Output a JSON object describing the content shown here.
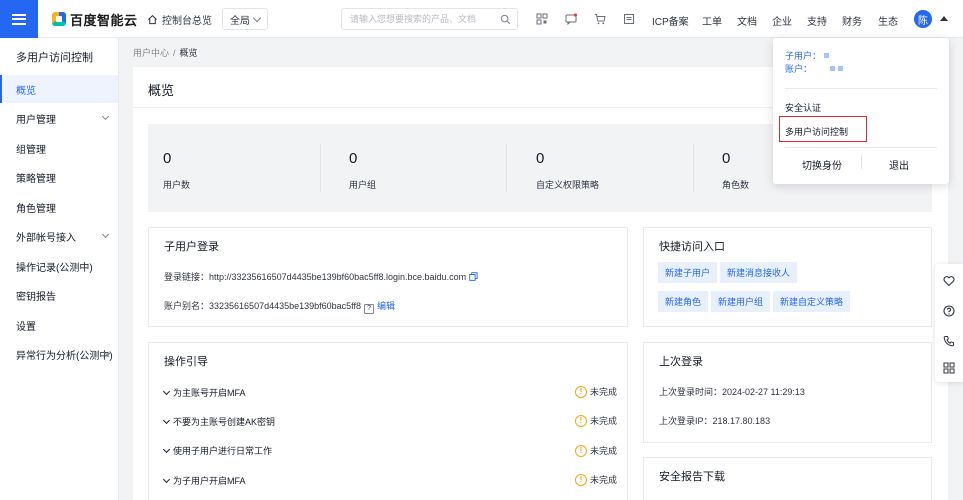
{
  "topbar": {
    "brand": "百度智能云",
    "home": "控制台总览",
    "region": "全局",
    "search_placeholder": "请输入您想要搜索的产品、文档",
    "nav": [
      "ICP备案",
      "工单",
      "文档",
      "企业",
      "支持",
      "财务",
      "生态"
    ],
    "avatar": "陈"
  },
  "sidebar": {
    "title": "多用户访问控制",
    "items": [
      {
        "label": "概览",
        "active": true
      },
      {
        "label": "用户管理",
        "expand": true
      },
      {
        "label": "组管理"
      },
      {
        "label": "策略管理"
      },
      {
        "label": "角色管理"
      },
      {
        "label": "外部帐号接入",
        "expand": true
      },
      {
        "label": "操作记录(公测中)"
      },
      {
        "label": "密钥报告"
      },
      {
        "label": "设置"
      },
      {
        "label": "异常行为分析(公测中)",
        "expand": true
      }
    ]
  },
  "breadcrumb": {
    "parent": "用户中心",
    "sep": "/",
    "current": "概览"
  },
  "page": {
    "title": "概览"
  },
  "stats": [
    {
      "value": "0",
      "label": "用户数"
    },
    {
      "value": "0",
      "label": "用户组"
    },
    {
      "value": "0",
      "label": "自定义权限策略"
    },
    {
      "value": "0",
      "label": "角色数"
    }
  ],
  "subuser": {
    "title": "子用户登录",
    "link_label": "登录链接：",
    "link_value": "http://33235616507d4435be139bf60bac5ff8.login.bce.baidu.com",
    "alias_label": "账户别名：",
    "alias_value": "33235616507d4435be139bf60bac5ff8",
    "help_mark": "?",
    "edit": "编辑"
  },
  "quick": {
    "title": "快捷访问入口",
    "buttons": [
      "新建子用户",
      "新建消息接收人",
      "新建角色",
      "新建用户组",
      "新建自定义策略"
    ]
  },
  "guide": {
    "title": "操作引导",
    "rows": [
      {
        "label": "为主账号开启MFA",
        "status": "未完成"
      },
      {
        "label": "不要为主账号创建AK密钥",
        "status": "未完成"
      },
      {
        "label": "使用子用户进行日常工作",
        "status": "未完成"
      },
      {
        "label": "为子用户开启MFA",
        "status": "未完成"
      }
    ],
    "warn_mark": "!"
  },
  "last_login": {
    "title": "上次登录",
    "time_label": "上次登录时间：",
    "time_value": "2024-02-27 11:29:13",
    "ip_label": "上次登录IP：",
    "ip_value": "218.17.80.183"
  },
  "security_report": {
    "title": "安全报告下载"
  },
  "dropdown": {
    "subuser_label": "子用户：",
    "account_label": "账户：",
    "items": [
      "安全认证",
      "多用户访问控制"
    ],
    "switch": "切换身份",
    "logout": "退出"
  },
  "float_icons": [
    "heart-icon",
    "help-icon",
    "phone-icon",
    "grid-icon"
  ],
  "colors": {
    "accent": "#2468f2",
    "warning": "#f3a716",
    "highlight": "#e0272e"
  }
}
